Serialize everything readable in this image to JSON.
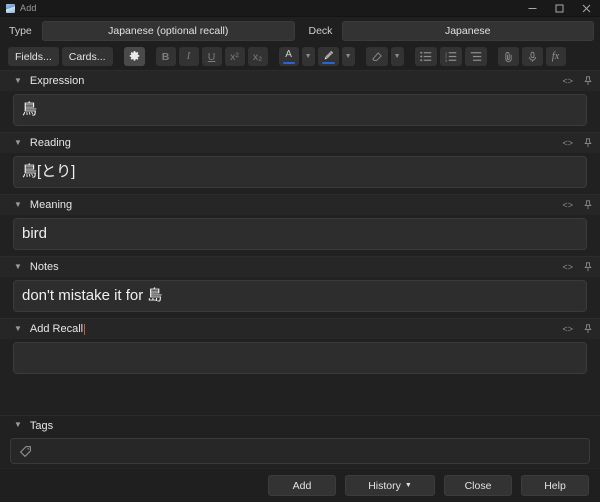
{
  "window": {
    "title": "Add",
    "app_icon": "anki-icon",
    "controls": {
      "minimize": "minimize-icon",
      "maximize": "maximize-icon",
      "close": "close-icon"
    }
  },
  "notetype_row": {
    "type_label": "Type",
    "type_value": "Japanese (optional recall)",
    "deck_label": "Deck",
    "deck_value": "Japanese"
  },
  "toolbar": {
    "fields_label": "Fields...",
    "cards_label": "Cards...",
    "settings_icon": "gear-icon",
    "bold_label": "B",
    "italic_label": "I",
    "underline_label": "U",
    "superscript_label": "x²",
    "subscript_label": "x₂",
    "text_color_label": "A",
    "text_color_swatch": "#2962d9",
    "text_color_chevron": "chevron-down-icon",
    "highlight_icon": "highlighter-pen-icon",
    "highlight_swatch": "#2962d9",
    "highlight_chevron": "chevron-down-icon",
    "remove_format_icon": "eraser-icon",
    "remove_format_chevron": "chevron-down-icon",
    "unordered_list_icon": "bullet-list-icon",
    "ordered_list_icon": "numbered-list-icon",
    "justify_icon": "text-align-icon",
    "attach_icon": "paperclip-icon",
    "record_icon": "microphone-icon",
    "equation_label": "fx"
  },
  "fields": [
    {
      "name": "Expression",
      "value": "鳥",
      "collapse_icon": "chevron-down-icon",
      "html_icon": "html-editor-icon",
      "html_label": "<>",
      "pin_icon": "pin-icon",
      "active": false
    },
    {
      "name": "Reading",
      "value": "鳥[とり]",
      "collapse_icon": "chevron-down-icon",
      "html_icon": "html-editor-icon",
      "html_label": "<>",
      "pin_icon": "pin-icon",
      "active": false
    },
    {
      "name": "Meaning",
      "value": "bird",
      "collapse_icon": "chevron-down-icon",
      "html_icon": "html-editor-icon",
      "html_label": "<>",
      "pin_icon": "pin-icon",
      "active": false
    },
    {
      "name": "Notes",
      "value": "don't mistake it for 島",
      "collapse_icon": "chevron-down-icon",
      "html_icon": "html-editor-icon",
      "html_label": "<>",
      "pin_icon": "pin-icon",
      "active": false
    },
    {
      "name": "Add Recall",
      "value": "",
      "collapse_icon": "chevron-down-icon",
      "html_icon": "html-editor-icon",
      "html_label": "<>",
      "pin_icon": "pin-icon",
      "active": true
    }
  ],
  "tags": {
    "label": "Tags",
    "collapse_icon": "chevron-down-icon",
    "icon": "tag-icon",
    "value": "",
    "placeholder": ""
  },
  "bottom_buttons": {
    "add_label": "Add",
    "history_label": "History",
    "history_caret": "▼",
    "close_label": "Close",
    "help_label": "Help"
  }
}
